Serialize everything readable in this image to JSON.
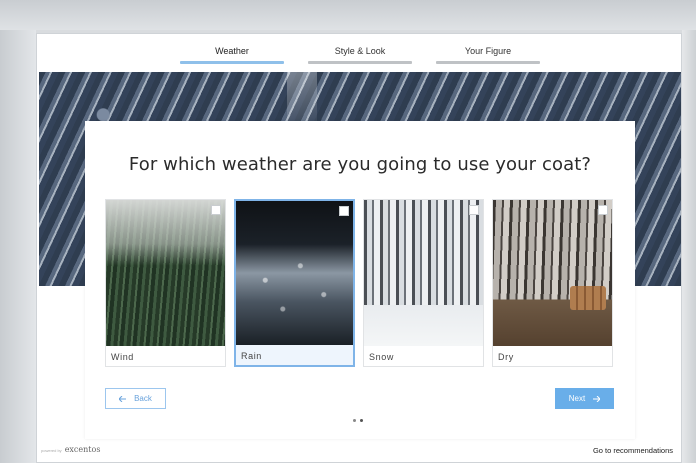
{
  "steps": [
    {
      "label": "Weather",
      "active": true
    },
    {
      "label": "Style & Look",
      "active": false
    },
    {
      "label": "Your Figure",
      "active": false
    }
  ],
  "question": "For which weather are you going to use your coat?",
  "options": [
    {
      "label": "Wind",
      "selected": false
    },
    {
      "label": "Rain",
      "selected": true
    },
    {
      "label": "Snow",
      "selected": false
    },
    {
      "label": "Dry",
      "selected": false
    }
  ],
  "nav": {
    "back_label": "Back",
    "next_label": "Next",
    "back_icon": "arrow-left-icon",
    "next_icon": "arrow-right-icon"
  },
  "footer": {
    "powered_by": "powered by",
    "brand": "excentos",
    "recommendations_link": "Go to recommendations"
  },
  "colors": {
    "accent": "#69aee9",
    "accent_border": "#7fb4e8",
    "active_step_bar": "#8fc0ea",
    "inactive_step_bar": "#bfc2c5"
  }
}
